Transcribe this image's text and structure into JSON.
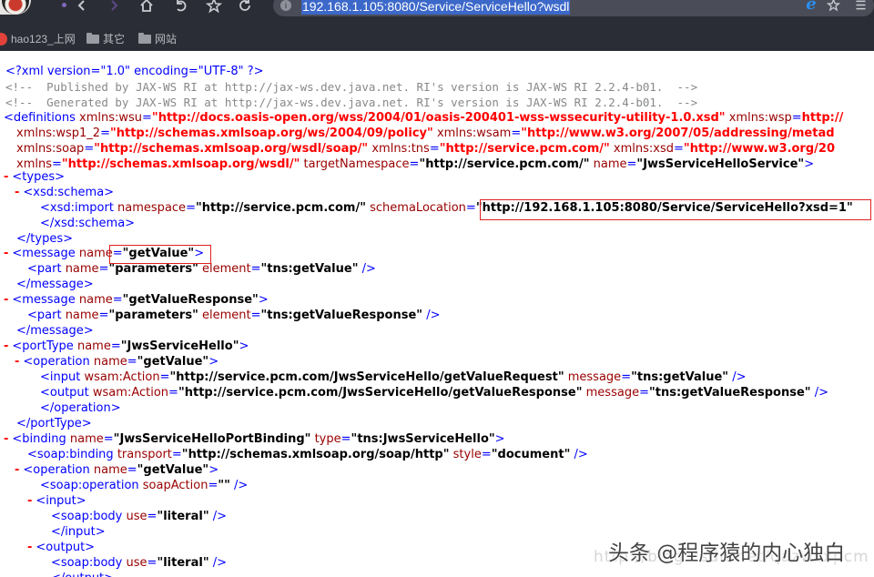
{
  "browser": {
    "url": "192.168.1.105:8080/Service/ServiceHello?wsdl",
    "site_icon": "i",
    "ie_glyph": "e",
    "icons": [
      "back-icon",
      "forward-icon",
      "home-icon",
      "undo-icon",
      "star-icon",
      "refresh-icon",
      "bookmark-star-icon",
      "menu-icon"
    ]
  },
  "bookmarks": [
    {
      "label": "hao123_上网",
      "icon": "hao123-icon"
    },
    {
      "label": "其它",
      "icon": "folder-icon"
    },
    {
      "label": "网站",
      "icon": "folder-icon"
    }
  ],
  "xml": {
    "decl": "<?xml version=\"1.0\" encoding=\"UTF-8\" ?>",
    "comment1": "<!--  Published by JAX-WS RI at http://jax-ws.dev.java.net. RI's version is JAX-WS RI 2.2.4-b01.  -->",
    "comment2": "<!--  Generated by JAX-WS RI at http://jax-ws.dev.java.net. RI's version is JAX-WS RI 2.2.4-b01.  -->",
    "ns_wsu": "http://docs.oasis-open.org/wss/2004/01/oasis-200401-wss-wssecurity-utility-1.0.xsd",
    "ns_wsp": "http://",
    "ns_wsp1_2": "http://schemas.xmlsoap.org/ws/2004/09/policy",
    "ns_wsam": "http://www.w3.org/2007/05/addressing/metad",
    "ns_soap": "http://schemas.xmlsoap.org/wsdl/soap/",
    "ns_tns": "http://service.pcm.com/",
    "ns_xsd": "http://www.w3.org/20",
    "ns_default": "http://schemas.xmlsoap.org/wsdl/",
    "target_namespace": "http://service.pcm.com/",
    "service_name": "JwsServiceHelloService",
    "import_namespace": "http://service.pcm.com/",
    "schema_location": "http://192.168.1.105:8080/Service/ServiceHello?xsd=1",
    "msg1_name": "getValue",
    "part_name": "parameters",
    "msg1_element": "tns:getValue",
    "msg2_name": "getValueResponse",
    "msg2_element": "tns:getValueResponse",
    "port_type_name": "JwsServiceHello",
    "operation_name": "getValue",
    "input_action": "http://service.pcm.com/JwsServiceHello/getValueRequest",
    "input_message": "tns:getValue",
    "output_action": "http://service.pcm.com/JwsServiceHello/getValueResponse",
    "output_message": "tns:getValueResponse",
    "binding_name": "JwsServiceHelloPortBinding",
    "binding_type": "tns:JwsServiceHello",
    "soap_transport": "http://schemas.xmlsoap.org/soap/http",
    "soap_style": "document",
    "soap_action": "",
    "body_use": "literal",
    "toggle": "-"
  },
  "watermark": {
    "blog": "http://blog.csdn.net/qazwsxpcm",
    "author": "头条 @程序猿的内心独白"
  }
}
